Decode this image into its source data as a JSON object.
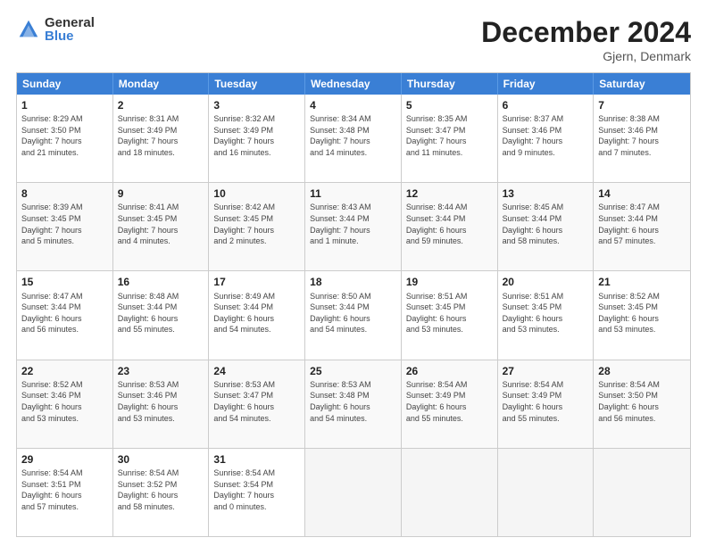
{
  "logo": {
    "general": "General",
    "blue": "Blue"
  },
  "title": "December 2024",
  "location": "Gjern, Denmark",
  "days": [
    "Sunday",
    "Monday",
    "Tuesday",
    "Wednesday",
    "Thursday",
    "Friday",
    "Saturday"
  ],
  "weeks": [
    [
      {
        "day": 1,
        "info": "Sunrise: 8:29 AM\nSunset: 3:50 PM\nDaylight: 7 hours\nand 21 minutes."
      },
      {
        "day": 2,
        "info": "Sunrise: 8:31 AM\nSunset: 3:49 PM\nDaylight: 7 hours\nand 18 minutes."
      },
      {
        "day": 3,
        "info": "Sunrise: 8:32 AM\nSunset: 3:49 PM\nDaylight: 7 hours\nand 16 minutes."
      },
      {
        "day": 4,
        "info": "Sunrise: 8:34 AM\nSunset: 3:48 PM\nDaylight: 7 hours\nand 14 minutes."
      },
      {
        "day": 5,
        "info": "Sunrise: 8:35 AM\nSunset: 3:47 PM\nDaylight: 7 hours\nand 11 minutes."
      },
      {
        "day": 6,
        "info": "Sunrise: 8:37 AM\nSunset: 3:46 PM\nDaylight: 7 hours\nand 9 minutes."
      },
      {
        "day": 7,
        "info": "Sunrise: 8:38 AM\nSunset: 3:46 PM\nDaylight: 7 hours\nand 7 minutes."
      }
    ],
    [
      {
        "day": 8,
        "info": "Sunrise: 8:39 AM\nSunset: 3:45 PM\nDaylight: 7 hours\nand 5 minutes."
      },
      {
        "day": 9,
        "info": "Sunrise: 8:41 AM\nSunset: 3:45 PM\nDaylight: 7 hours\nand 4 minutes."
      },
      {
        "day": 10,
        "info": "Sunrise: 8:42 AM\nSunset: 3:45 PM\nDaylight: 7 hours\nand 2 minutes."
      },
      {
        "day": 11,
        "info": "Sunrise: 8:43 AM\nSunset: 3:44 PM\nDaylight: 7 hours\nand 1 minute."
      },
      {
        "day": 12,
        "info": "Sunrise: 8:44 AM\nSunset: 3:44 PM\nDaylight: 6 hours\nand 59 minutes."
      },
      {
        "day": 13,
        "info": "Sunrise: 8:45 AM\nSunset: 3:44 PM\nDaylight: 6 hours\nand 58 minutes."
      },
      {
        "day": 14,
        "info": "Sunrise: 8:47 AM\nSunset: 3:44 PM\nDaylight: 6 hours\nand 57 minutes."
      }
    ],
    [
      {
        "day": 15,
        "info": "Sunrise: 8:47 AM\nSunset: 3:44 PM\nDaylight: 6 hours\nand 56 minutes."
      },
      {
        "day": 16,
        "info": "Sunrise: 8:48 AM\nSunset: 3:44 PM\nDaylight: 6 hours\nand 55 minutes."
      },
      {
        "day": 17,
        "info": "Sunrise: 8:49 AM\nSunset: 3:44 PM\nDaylight: 6 hours\nand 54 minutes."
      },
      {
        "day": 18,
        "info": "Sunrise: 8:50 AM\nSunset: 3:44 PM\nDaylight: 6 hours\nand 54 minutes."
      },
      {
        "day": 19,
        "info": "Sunrise: 8:51 AM\nSunset: 3:45 PM\nDaylight: 6 hours\nand 53 minutes."
      },
      {
        "day": 20,
        "info": "Sunrise: 8:51 AM\nSunset: 3:45 PM\nDaylight: 6 hours\nand 53 minutes."
      },
      {
        "day": 21,
        "info": "Sunrise: 8:52 AM\nSunset: 3:45 PM\nDaylight: 6 hours\nand 53 minutes."
      }
    ],
    [
      {
        "day": 22,
        "info": "Sunrise: 8:52 AM\nSunset: 3:46 PM\nDaylight: 6 hours\nand 53 minutes."
      },
      {
        "day": 23,
        "info": "Sunrise: 8:53 AM\nSunset: 3:46 PM\nDaylight: 6 hours\nand 53 minutes."
      },
      {
        "day": 24,
        "info": "Sunrise: 8:53 AM\nSunset: 3:47 PM\nDaylight: 6 hours\nand 54 minutes."
      },
      {
        "day": 25,
        "info": "Sunrise: 8:53 AM\nSunset: 3:48 PM\nDaylight: 6 hours\nand 54 minutes."
      },
      {
        "day": 26,
        "info": "Sunrise: 8:54 AM\nSunset: 3:49 PM\nDaylight: 6 hours\nand 55 minutes."
      },
      {
        "day": 27,
        "info": "Sunrise: 8:54 AM\nSunset: 3:49 PM\nDaylight: 6 hours\nand 55 minutes."
      },
      {
        "day": 28,
        "info": "Sunrise: 8:54 AM\nSunset: 3:50 PM\nDaylight: 6 hours\nand 56 minutes."
      }
    ],
    [
      {
        "day": 29,
        "info": "Sunrise: 8:54 AM\nSunset: 3:51 PM\nDaylight: 6 hours\nand 57 minutes."
      },
      {
        "day": 30,
        "info": "Sunrise: 8:54 AM\nSunset: 3:52 PM\nDaylight: 6 hours\nand 58 minutes."
      },
      {
        "day": 31,
        "info": "Sunrise: 8:54 AM\nSunset: 3:54 PM\nDaylight: 7 hours\nand 0 minutes."
      },
      {
        "day": null,
        "info": ""
      },
      {
        "day": null,
        "info": ""
      },
      {
        "day": null,
        "info": ""
      },
      {
        "day": null,
        "info": ""
      }
    ]
  ]
}
